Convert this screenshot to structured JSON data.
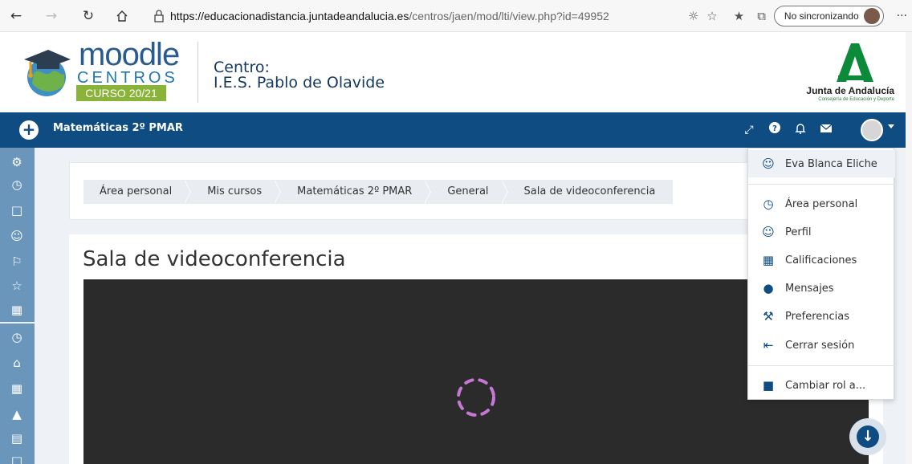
{
  "browser": {
    "url_host": "https://educacionadistancia.juntadeandalucia.es",
    "url_path": "/centros/jaen/mod/lti/view.php?id=49952",
    "sync_label": "No sincronizando",
    "more_label": "···"
  },
  "header": {
    "logo_word": "moodle",
    "logo_sub": "CENTROS",
    "course_year": "CURSO 20/21",
    "centro_label": "Centro:",
    "centro_name": "I.E.S. Pablo de Olavide",
    "junta_name": "Junta de Andalucía",
    "junta_sub": "Consejería de Educación y Deporte"
  },
  "navbar": {
    "course_title": "Matemáticas 2º PMAR",
    "plus_glyph": "+"
  },
  "breadcrumb": [
    {
      "label": "Área personal"
    },
    {
      "label": "Mis cursos"
    },
    {
      "label": "Matemáticas 2º PMAR"
    },
    {
      "label": "General"
    },
    {
      "label": "Sala de videoconferencia"
    }
  ],
  "main": {
    "title": "Sala de videoconferencia"
  },
  "user_menu": {
    "user_name": "Eva Blanca Eliche",
    "items": [
      {
        "label": "Área personal",
        "icon": "dashboard-icon"
      },
      {
        "label": "Perfil",
        "icon": "user-icon"
      },
      {
        "label": "Calificaciones",
        "icon": "grades-icon"
      },
      {
        "label": "Mensajes",
        "icon": "message-icon"
      },
      {
        "label": "Preferencias",
        "icon": "wrench-icon"
      },
      {
        "label": "Cerrar sesión",
        "icon": "logout-icon"
      }
    ],
    "switch_role": "Cambiar rol a..."
  },
  "colors": {
    "navbar": "#0f4c81",
    "drawer": "#6a96bc",
    "video": "#2b2b2b",
    "spinner": "#c777d6",
    "curso_green": "#8ab339"
  }
}
